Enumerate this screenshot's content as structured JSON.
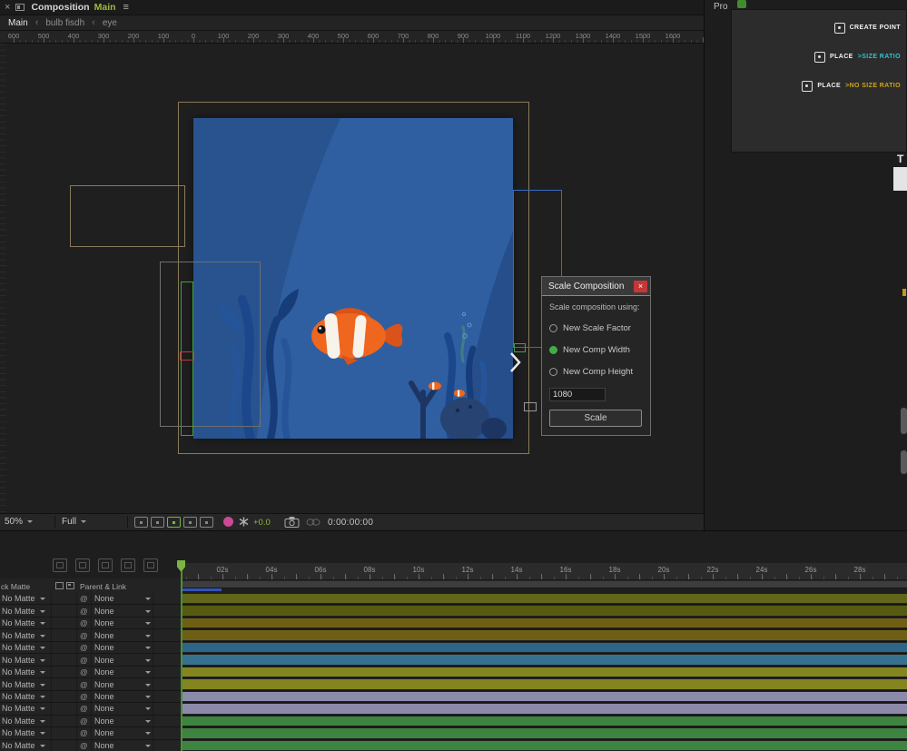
{
  "composition_panel": {
    "tab": {
      "close": "×",
      "panel_title": "Composition",
      "comp_name": "Main",
      "comp_name_color": "#9db83e",
      "menu": "≡"
    },
    "breadcrumb_separator": "‹",
    "breadcrumbs": [
      {
        "label": "Main",
        "active": true
      },
      {
        "label": "bulb fisdh",
        "active": false
      },
      {
        "label": "eye",
        "active": false
      }
    ],
    "ruler_labels": [
      "600",
      "500",
      "400",
      "300",
      "200",
      "100",
      "0",
      "100",
      "200",
      "300",
      "400",
      "500",
      "600",
      "700",
      "800",
      "900",
      "1000",
      "1100",
      "1200",
      "1300",
      "1400",
      "1500",
      "1600"
    ]
  },
  "scene": {
    "water": "#2f5fa0",
    "water_dark": "#28538f",
    "water_darker": "#254e8a",
    "seaweed1": "#1c478c",
    "seaweed2": "#255499",
    "seaweed3": "#163d7a",
    "coral": "#1d3562",
    "coral2": "#264371",
    "fish_body": "#ef661f",
    "fish_stripe": "#f7f3ea",
    "fish_fin": "#d9531a"
  },
  "scale_dialog": {
    "title": "Scale Composition",
    "close": "×",
    "prompt": "Scale composition using:",
    "selected_color": "#3fae49",
    "options": [
      {
        "label": "New Scale Factor",
        "selected": false
      },
      {
        "label": "New Comp Width",
        "selected": true
      },
      {
        "label": "New Comp Height",
        "selected": false
      }
    ],
    "width_value": "1080",
    "scale_button": "Scale"
  },
  "properties_panel": {
    "tab_label": "Pro",
    "side_label": "T",
    "buttons": [
      {
        "name": "create-point-button",
        "label": "CREATE POINT",
        "suffix": "",
        "suffix_color": "#ffffff"
      },
      {
        "name": "place-size-ratio-button",
        "label": "PLACE",
        "suffix": " >SIZE RATIO",
        "suffix_color": "#2fc4d4"
      },
      {
        "name": "place-no-size-ratio-button",
        "label": "PLACE",
        "suffix": " >NO SIZE RATIO",
        "suffix_color": "#d2a41c"
      }
    ]
  },
  "viewport_toolbar": {
    "zoom": "50%",
    "resolution": "Full",
    "exposure": "+0.0",
    "timecode": "0:00:00:00"
  },
  "timeline": {
    "ruler_labels": [
      "02s",
      "04s",
      "06s",
      "08s",
      "10s",
      "12s",
      "14s",
      "16s",
      "18s",
      "20s",
      "22s",
      "24s",
      "26s",
      "28s"
    ],
    "header": {
      "track_matte": "ck Matte",
      "parent_link": "Parent & Link"
    },
    "row_defaults": {
      "pickwhip": "@"
    },
    "rows": [
      {
        "matte": "No Matte",
        "parent": "None",
        "color": "#62661c"
      },
      {
        "matte": "No Matte",
        "parent": "None",
        "color": "#575b11"
      },
      {
        "matte": "No Matte",
        "parent": "None",
        "color": "#6f5f14"
      },
      {
        "matte": "No Matte",
        "parent": "None",
        "color": "#6f5f14"
      },
      {
        "matte": "No Matte",
        "parent": "None",
        "color": "#2d6686"
      },
      {
        "matte": "No Matte",
        "parent": "None",
        "color": "#36718f"
      },
      {
        "matte": "No Matte",
        "parent": "None",
        "color": "#84851f"
      },
      {
        "matte": "No Matte",
        "parent": "None",
        "color": "#84851f"
      },
      {
        "matte": "No Matte",
        "parent": "None",
        "color": "#8c8aaa"
      },
      {
        "matte": "No Matte",
        "parent": "None",
        "color": "#8c8aaa"
      },
      {
        "matte": "No Matte",
        "parent": "None",
        "color": "#3d8440"
      },
      {
        "matte": "No Matte",
        "parent": "None",
        "color": "#3d8440"
      },
      {
        "matte": "No Matte",
        "parent": "None",
        "color": "#3d8440"
      }
    ]
  }
}
